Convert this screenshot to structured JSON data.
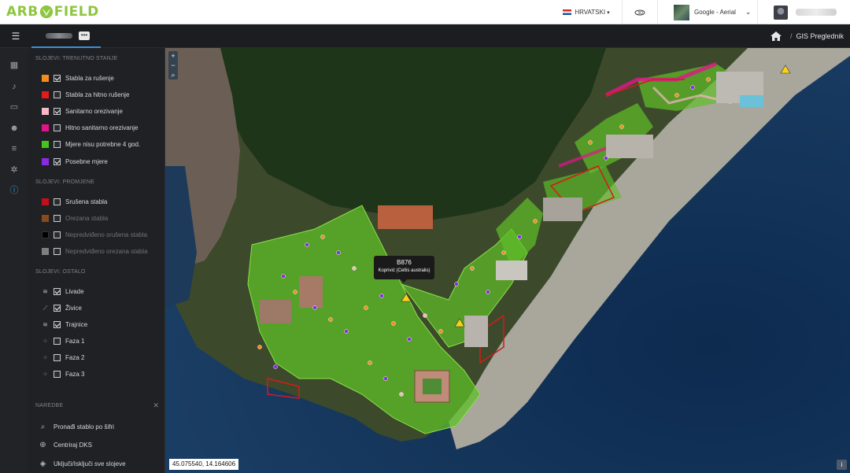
{
  "topbar": {
    "logo_left": "ARB",
    "logo_right": "FIELD",
    "language": "HRVATSKI",
    "basemap_label": "Google - Aerial"
  },
  "subbar": {
    "breadcrumb_page": "GIS Preglednik"
  },
  "panel": {
    "section_current": "SLOJEVI: TRENUTNO STANJE",
    "current_layers": [
      {
        "label": "Stabla za rušenje",
        "color": "#f28c1e",
        "checked": true
      },
      {
        "label": "Stabla za hitno rušenje",
        "color": "#e31b1b",
        "checked": false
      },
      {
        "label": "Sanitarno orezivanje",
        "color": "#f6b7c6",
        "checked": true
      },
      {
        "label": "Hitno sanitarno orezivanje",
        "color": "#e0158a",
        "checked": false
      },
      {
        "label": "Mjere nisu potrebne 4 god.",
        "color": "#45c41d",
        "checked": false
      },
      {
        "label": "Posebne mjere",
        "color": "#8a2be2",
        "checked": true
      }
    ],
    "section_changes": "SLOJEVI: PROMJENE",
    "change_layers": [
      {
        "label": "Srušena stabla",
        "color": "#c0111a",
        "checked": false
      },
      {
        "label": "Orezana stabla",
        "color": "#8a4a1a",
        "checked": false
      },
      {
        "label": "Nepredviđeno srušena stabla",
        "color": "#000000",
        "checked": false
      },
      {
        "label": "Nepredviđeno orezana stabla",
        "color": "#7f7f7f",
        "checked": false
      }
    ],
    "section_other": "SLOJEVI: OSTALO",
    "other_layers": [
      {
        "label": "Livade",
        "icon": "meadow-icon",
        "checked": true
      },
      {
        "label": "Živice",
        "icon": "hedge-icon",
        "checked": true
      },
      {
        "label": "Trajnice",
        "icon": "perennial-icon",
        "checked": true
      },
      {
        "label": "Faza 1",
        "icon": "phase-icon",
        "checked": false
      },
      {
        "label": "Faza 2",
        "icon": "phase-icon",
        "checked": false
      },
      {
        "label": "Faza 3",
        "icon": "phase-icon",
        "checked": false
      }
    ],
    "section_commands": "NAREDBE",
    "commands": [
      {
        "label": "Pronađi stablo po šifri",
        "icon": "search-icon"
      },
      {
        "label": "Centriraj DKS",
        "icon": "crosshair-icon"
      },
      {
        "label": "Uključi/Isključi sve slojeve",
        "icon": "layers-icon"
      }
    ]
  },
  "map": {
    "tooltip_id": "B876",
    "tooltip_name": "Koprivić (Celtis australis)",
    "coordinates": "45.075540, 14.164606",
    "info_label": "i"
  }
}
